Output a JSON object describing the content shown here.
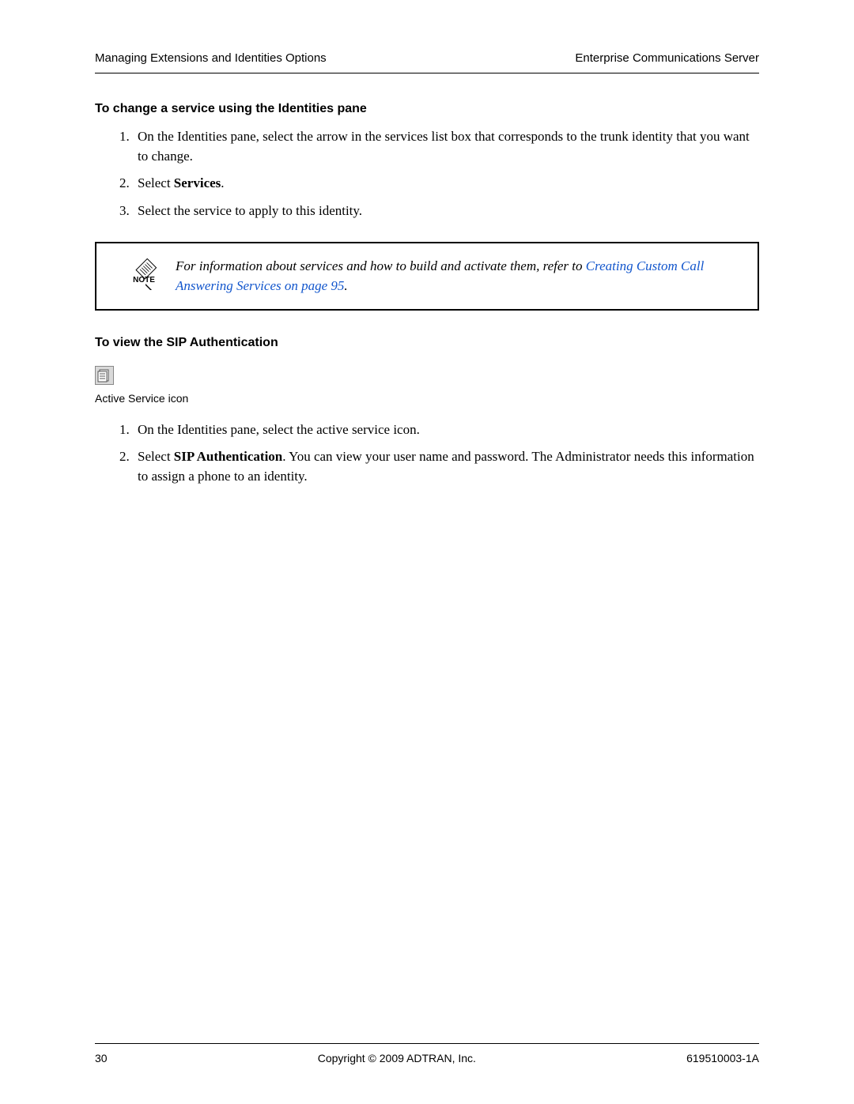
{
  "header": {
    "left": "Managing Extensions and Identities Options",
    "right": "Enterprise Communications Server"
  },
  "section1": {
    "heading": "To change a service using the Identities pane",
    "items": [
      {
        "pre": "On the Identities pane, select the arrow in the services list box that corresponds to the trunk identity that you want to change."
      },
      {
        "pre": "Select ",
        "bold": "Services",
        "post": "."
      },
      {
        "pre": "Select the service to apply to this identity."
      }
    ]
  },
  "note": {
    "label": "NOTE",
    "text_pre": "For information about services and how to build and activate them, refer to ",
    "link": "Creating Custom Call Answering Services on page 95",
    "text_post": "."
  },
  "section2": {
    "heading": "To view the SIP Authentication",
    "icon_caption": "Active Service icon",
    "items": [
      {
        "pre": "On the Identities pane, select the active service icon."
      },
      {
        "pre": "Select ",
        "bold": "SIP Authentication",
        "post": ". You can view your user name and password. The Administrator needs this information to assign a phone to an identity."
      }
    ]
  },
  "footer": {
    "left": "30",
    "center": "Copyright © 2009 ADTRAN, Inc.",
    "right": "619510003-1A"
  }
}
